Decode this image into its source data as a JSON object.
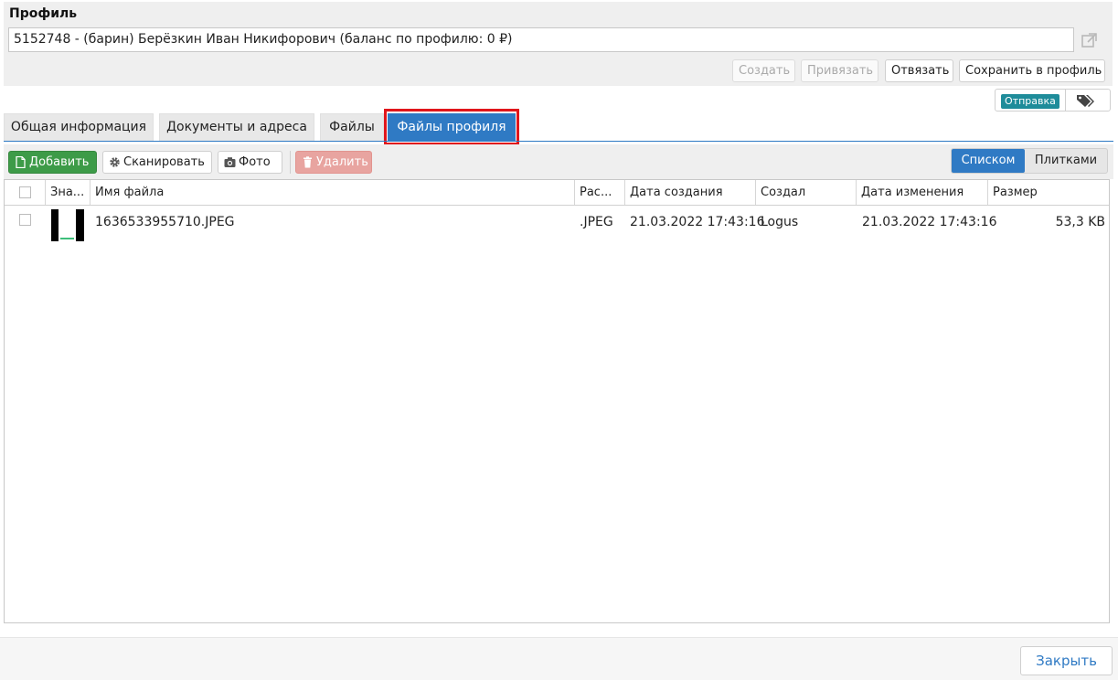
{
  "profile": {
    "title": "Профиль",
    "value": "5152748 - (барин) Берёзкин Иван Никифорович (баланс по профилю: 0 ₽)",
    "buttons": {
      "create": "Создать",
      "bind": "Привязать",
      "unbind": "Отвязать",
      "save": "Сохранить в профиль"
    },
    "badge": "Отправка"
  },
  "tabs": [
    {
      "label": "Общая информация"
    },
    {
      "label": "Документы и адреса"
    },
    {
      "label": "Файлы"
    },
    {
      "label": "Файлы профиля"
    }
  ],
  "toolbar": {
    "add": "Добавить",
    "scan": "Сканировать",
    "photo": "Фото",
    "delete": "Удалить",
    "view_list": "Списком",
    "view_tiles": "Плитками"
  },
  "table": {
    "columns": [
      "Зна...",
      "Имя файла",
      "Рас...",
      "Дата создания",
      "Создал",
      "Дата изменения",
      "Размер"
    ],
    "rows": [
      {
        "name": "1636533955710.JPEG",
        "ext": ".JPEG",
        "created": "21.03.2022 17:43:16",
        "author": "Logus",
        "modified": "21.03.2022 17:43:16",
        "size": "53,3 KB"
      }
    ]
  },
  "footer": {
    "close": "Закрыть"
  },
  "colors": {
    "accent": "#2f7ac4",
    "add_green": "#3d9b48",
    "delete_red": "#e8a4a0",
    "badge_teal": "#1e8c9a",
    "highlight": "#e0161c"
  }
}
